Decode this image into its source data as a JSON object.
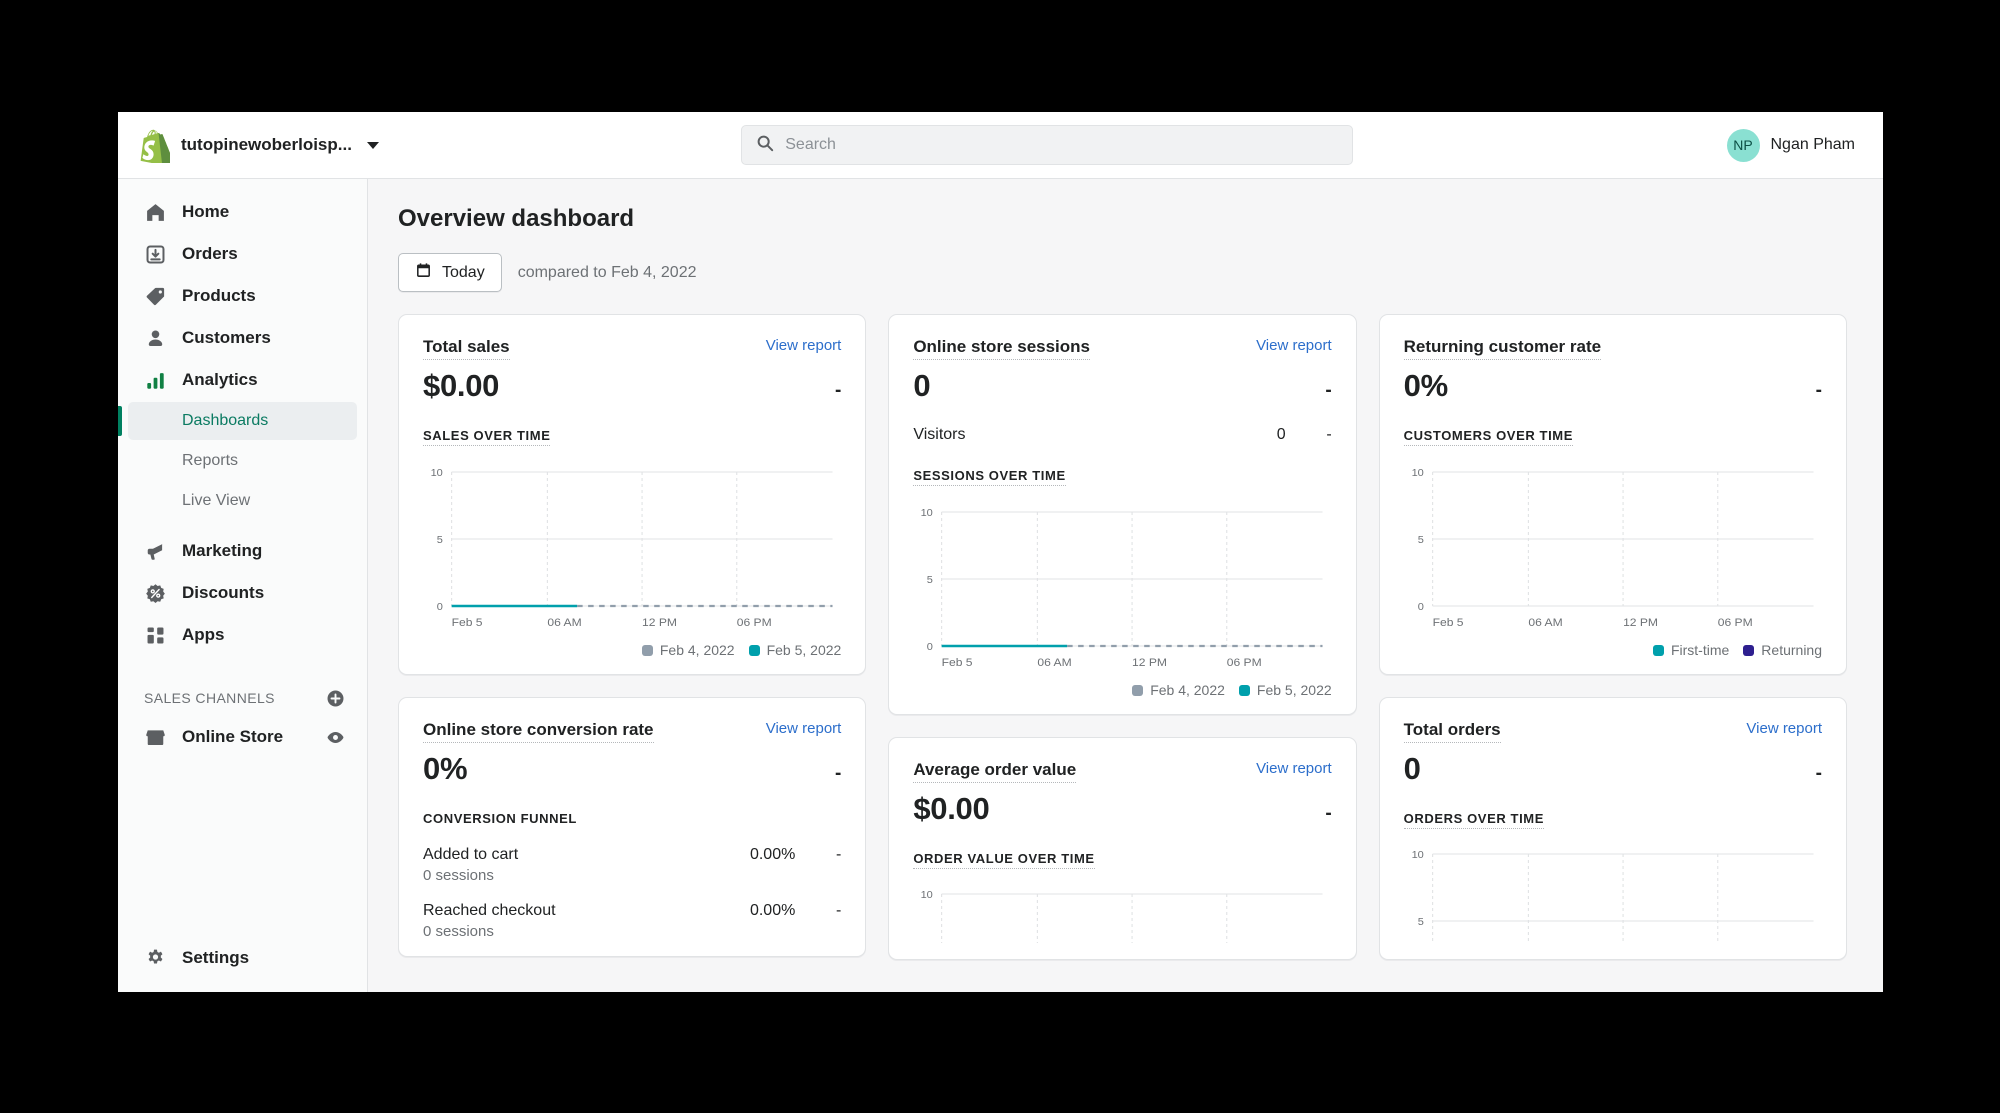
{
  "topbar": {
    "store_name": "tutopinewoberloisp...",
    "search_placeholder": "Search",
    "user_initials": "NP",
    "user_name": "Ngan Pham"
  },
  "sidebar": {
    "items": [
      {
        "label": "Home",
        "icon": "home-icon"
      },
      {
        "label": "Orders",
        "icon": "orders-icon"
      },
      {
        "label": "Products",
        "icon": "products-tag-icon"
      },
      {
        "label": "Customers",
        "icon": "customers-icon"
      },
      {
        "label": "Analytics",
        "icon": "analytics-bars-icon"
      }
    ],
    "sub_items": [
      {
        "label": "Dashboards",
        "active": true
      },
      {
        "label": "Reports",
        "active": false
      },
      {
        "label": "Live View",
        "active": false
      }
    ],
    "items_lower": [
      {
        "label": "Marketing",
        "icon": "megaphone-icon"
      },
      {
        "label": "Discounts",
        "icon": "discount-percent-icon"
      },
      {
        "label": "Apps",
        "icon": "apps-grid-icon"
      }
    ],
    "sales_channels_title": "SALES CHANNELS",
    "add_channel_icon": "plus-circle-icon",
    "channels": [
      {
        "label": "Online Store",
        "icon": "storefront-icon",
        "action_icon": "eye-icon"
      }
    ],
    "settings": {
      "label": "Settings",
      "icon": "gear-icon"
    }
  },
  "main": {
    "page_title": "Overview dashboard",
    "date_button": {
      "label": "Today",
      "icon": "calendar-icon"
    },
    "compared_to": "compared to Feb 4, 2022",
    "view_report_label": "View report"
  },
  "legends": {
    "compare": [
      {
        "label": "Feb 4, 2022",
        "color": "#919eab"
      },
      {
        "label": "Feb 5, 2022",
        "color": "#00a0ac"
      }
    ],
    "customers": [
      {
        "label": "First-time",
        "color": "#00a0ac"
      },
      {
        "label": "Returning",
        "color": "#2e1f8f"
      }
    ]
  },
  "cards": {
    "total_sales": {
      "title": "Total sales",
      "value": "$0.00",
      "delta": "-",
      "chart_label": "SALES OVER TIME"
    },
    "sessions": {
      "title": "Online store sessions",
      "value": "0",
      "delta": "-",
      "sub_name": "Visitors",
      "sub_value": "0",
      "sub_delta": "-",
      "chart_label": "SESSIONS OVER TIME"
    },
    "returning_rate": {
      "title": "Returning customer rate",
      "value": "0%",
      "delta": "-",
      "chart_label": "CUSTOMERS OVER TIME"
    },
    "conversion": {
      "title": "Online store conversion rate",
      "value": "0%",
      "delta": "-",
      "chart_label": "CONVERSION FUNNEL",
      "funnel": [
        {
          "name": "Added to cart",
          "sub": "0 sessions",
          "pct": "0.00%",
          "delta": "-"
        },
        {
          "name": "Reached checkout",
          "sub": "0 sessions",
          "pct": "0.00%",
          "delta": "-"
        }
      ]
    },
    "aov": {
      "title": "Average order value",
      "value": "$0.00",
      "delta": "-",
      "chart_label": "ORDER VALUE OVER TIME"
    },
    "total_orders": {
      "title": "Total orders",
      "value": "0",
      "delta": "-",
      "chart_label": "ORDERS OVER TIME"
    }
  },
  "chart_data": [
    {
      "id": "sales_over_time",
      "type": "line",
      "title": "SALES OVER TIME",
      "xlabel": "",
      "ylabel": "",
      "ylim": [
        0,
        10
      ],
      "yticks": [
        0,
        5,
        10
      ],
      "xticks": [
        "Feb 5",
        "06 AM",
        "12 PM",
        "06 PM"
      ],
      "grid": true,
      "series": [
        {
          "name": "Feb 5, 2022",
          "color": "#00a0ac",
          "style": "solid",
          "x": [
            "Feb 5",
            "06 AM"
          ],
          "values": [
            0,
            0
          ]
        },
        {
          "name": "Feb 4, 2022",
          "color": "#919eab",
          "style": "dashed",
          "x": [
            "06 AM",
            "12 PM",
            "06 PM"
          ],
          "values": [
            0,
            0,
            0
          ]
        }
      ]
    },
    {
      "id": "sessions_over_time",
      "type": "line",
      "title": "SESSIONS OVER TIME",
      "ylim": [
        0,
        10
      ],
      "yticks": [
        0,
        5,
        10
      ],
      "xticks": [
        "Feb 5",
        "06 AM",
        "12 PM",
        "06 PM"
      ],
      "grid": true,
      "series": [
        {
          "name": "Feb 5, 2022",
          "color": "#00a0ac",
          "style": "solid",
          "x": [
            "Feb 5",
            "06 AM"
          ],
          "values": [
            0,
            0
          ]
        },
        {
          "name": "Feb 4, 2022",
          "color": "#919eab",
          "style": "dashed",
          "x": [
            "06 AM",
            "12 PM",
            "06 PM"
          ],
          "values": [
            0,
            0,
            0
          ]
        }
      ]
    },
    {
      "id": "customers_over_time",
      "type": "bar",
      "title": "CUSTOMERS OVER TIME",
      "ylim": [
        0,
        10
      ],
      "yticks": [
        0,
        5,
        10
      ],
      "xticks": [
        "Feb 5",
        "06 AM",
        "12 PM",
        "06 PM"
      ],
      "grid": true,
      "series": [
        {
          "name": "First-time",
          "color": "#00a0ac",
          "values": [
            0,
            0,
            0,
            0
          ]
        },
        {
          "name": "Returning",
          "color": "#2e1f8f",
          "values": [
            0,
            0,
            0,
            0
          ]
        }
      ]
    },
    {
      "id": "order_value_over_time",
      "type": "line",
      "title": "ORDER VALUE OVER TIME",
      "ylim": [
        0,
        10
      ],
      "yticks": [
        10
      ],
      "xticks": [],
      "grid": true,
      "series": []
    },
    {
      "id": "orders_over_time",
      "type": "line",
      "title": "ORDERS OVER TIME",
      "ylim": [
        0,
        10
      ],
      "yticks": [
        5,
        10
      ],
      "xticks": [],
      "grid": true,
      "series": []
    }
  ]
}
